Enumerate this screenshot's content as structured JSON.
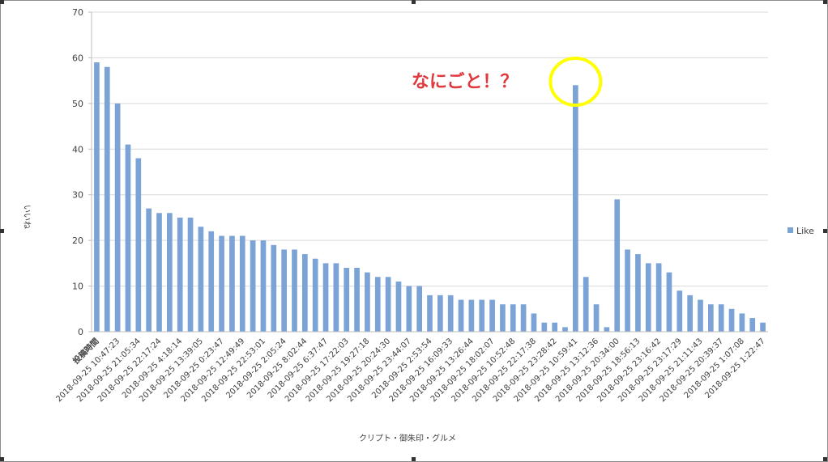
{
  "chart_data": {
    "type": "bar",
    "title": "",
    "xlabel": "クリプト・御朱印・グルメ",
    "ylabel": "いいね",
    "ylim": [
      0,
      70
    ],
    "yticks": [
      0,
      10,
      20,
      30,
      40,
      50,
      60,
      70
    ],
    "grid": true,
    "legend_position": "right",
    "bar_color": "#7ba3d6",
    "categories": [
      "投稿時間",
      "",
      "2018-09-25 10:47:23",
      "",
      "2018-09-25 21:05:34",
      "",
      "2018-09-25 22:17:24",
      "",
      "2018-09-25 4:18:14",
      "",
      "2018-09-25 13:39:05",
      "",
      "2018-09-25 0:23:47",
      "",
      "2018-09-25 12:49:49",
      "",
      "2018-09-25 22:53:01",
      "",
      "2018-09-25 2:05:24",
      "",
      "2018-09-25 8:02:44",
      "",
      "2018-09-25 6:37:47",
      "",
      "2018-09-25 17:22:03",
      "",
      "2018-09-25 19:27:18",
      "",
      "2018-09-25 20:24:30",
      "",
      "2018-09-25 23:44:07",
      "",
      "2018-09-25 2:53:54",
      "",
      "2018-09-25 16:09:33",
      "",
      "2018-09-25 13:26:44",
      "",
      "2018-09-25 18:02:07",
      "",
      "2018-09-25 10:52:48",
      "",
      "2018-09-25 22:17:38",
      "",
      "2018-09-25 23:28:42",
      "",
      "2018-09-25 10:59:41",
      "",
      "2018-09-25 13:12:36",
      "",
      "2018-09-25 20:34:00",
      "",
      "2018-09-25 18:56:13",
      "",
      "2018-09-25 23:16:42",
      "",
      "2018-09-25 23:17:29",
      "",
      "2018-09-25 21:11:43",
      "",
      "2018-09-25 20:39:37",
      "",
      "2018-09-25 1:07:08",
      "",
      "2018-09-25 1:22:47"
    ],
    "series": [
      {
        "name": "Like",
        "values": [
          59,
          58,
          50,
          41,
          38,
          27,
          26,
          26,
          25,
          25,
          23,
          22,
          21,
          21,
          21,
          20,
          20,
          19,
          18,
          18,
          17,
          16,
          15,
          15,
          14,
          14,
          13,
          12,
          12,
          11,
          10,
          10,
          8,
          8,
          8,
          7,
          7,
          7,
          7,
          6,
          6,
          6,
          4,
          2,
          2,
          1,
          54,
          12,
          6,
          1,
          29,
          18,
          17,
          15,
          15,
          13,
          9,
          8,
          7,
          6,
          6,
          5,
          4,
          3,
          2
        ]
      }
    ],
    "annotations": [
      {
        "text": "なにごと！？",
        "target_index": 46,
        "color": "#e0393e",
        "circle_color": "#ffff00"
      }
    ]
  }
}
